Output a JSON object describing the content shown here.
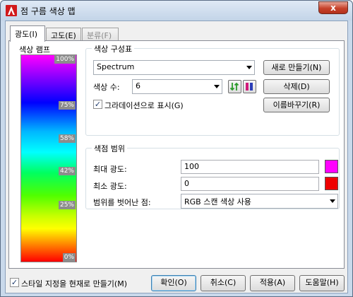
{
  "window": {
    "title": "점 구름 색상 맵",
    "close_glyph": "x"
  },
  "tabs": [
    {
      "label": "광도(I)",
      "state": "active"
    },
    {
      "label": "고도(E)",
      "state": "normal"
    },
    {
      "label": "분류(F)",
      "state": "disabled"
    }
  ],
  "ramp": {
    "title": "색상 램프",
    "markers": [
      "100%",
      "75%",
      "58%",
      "42%",
      "25%",
      "0%"
    ]
  },
  "scheme": {
    "title": "색상 구성표",
    "selected": "Spectrum",
    "new_button": "새로 만들기(N)",
    "count_label": "색상 수:",
    "count_value": "6",
    "delete_button": "삭제(D)",
    "gradient_label": "그라데이션으로 표시(G)",
    "gradient_checked": true,
    "rename_button": "이름바꾸기(R)"
  },
  "range": {
    "title": "색점 범위",
    "max_label": "최대 광도:",
    "max_value": "100",
    "max_color": "#ff00ff",
    "min_label": "최소 광도:",
    "min_value": "0",
    "min_color": "#ee0000",
    "outside_label": "범위를 벗어난 점:",
    "outside_value": "RGB 스캔 색상 사용"
  },
  "footer": {
    "style_current_label": "스타일 지정을 현재로 만들기(M)",
    "style_current_checked": true,
    "ok": "확인(O)",
    "cancel": "취소(C)",
    "apply": "적용(A)",
    "help": "도움말(H)"
  }
}
